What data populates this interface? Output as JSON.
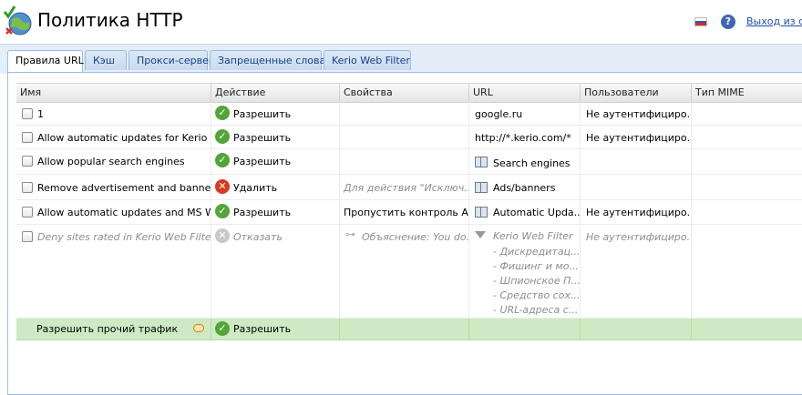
{
  "header": {
    "title": "Политика HTTP",
    "logout_label": "Выход из си"
  },
  "tabs": [
    {
      "label": "Правила URL",
      "active": true
    },
    {
      "label": "Кэш"
    },
    {
      "label": "Прокси-сервер"
    },
    {
      "label": "Запрещенные слова"
    },
    {
      "label": "Kerio Web Filter"
    }
  ],
  "columns": [
    "Имя",
    "Действие",
    "Свойства",
    "URL",
    "Пользователи",
    "Тип MIME"
  ],
  "rows": [
    {
      "name": "1",
      "action": "Разрешить",
      "action_type": "allow",
      "properties": "",
      "url": "google.ru",
      "url_icon": "",
      "users": "Не аутентифициро..."
    },
    {
      "name": "Allow automatic updates for Kerio sof...",
      "action": "Разрешить",
      "action_type": "allow",
      "properties": "",
      "url": "http://*.kerio.com/*",
      "url_icon": "",
      "users": "Не аутентифициро..."
    },
    {
      "name": "Allow popular search engines",
      "action": "Разрешить",
      "action_type": "allow",
      "properties": "",
      "url": "Search engines",
      "url_icon": "url-group-icon",
      "users": ""
    },
    {
      "name": "Remove advertisement and banners",
      "action": "Удалить",
      "action_type": "deny",
      "properties": "Для действия \"Исключ...",
      "url": "Ads/banners",
      "url_icon": "url-group-icon",
      "users": ""
    },
    {
      "name": "Allow automatic updates and MS Win...",
      "action": "Разрешить",
      "action_type": "allow",
      "properties": "Пропустить контроль АВ",
      "url": "Automatic Upda...",
      "url_icon": "url-group-icon",
      "users": "Не аутентифициро..."
    }
  ],
  "disabled_row": {
    "name": "Deny sites rated in Kerio Web Filter c...",
    "action": "Отказать",
    "properties": "Объяснение: You do...",
    "url": "Kerio Web Filter",
    "url_items": [
      "- Дискредитац...",
      "- Фишинг и мо...",
      "- Шпионское П...",
      "- Средство сох...",
      "- URL-адреса с..."
    ],
    "users": "Не аутентифициро..."
  },
  "default_row": {
    "name": "Разрешить прочий трафик",
    "action": "Разрешить"
  },
  "colors": {
    "accent": "#15428b",
    "allow": "#53a537",
    "deny": "#d63a24",
    "default_row_bg": "#cdeac4"
  }
}
